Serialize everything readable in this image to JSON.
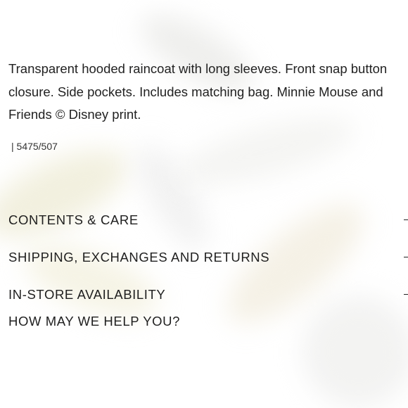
{
  "product": {
    "description": "Transparent hooded raincoat with long sleeves. Front snap button closure. Side pockets. Includes matching bag. Minnie Mouse and Friends © Disney print.",
    "reference": "| 5475/507"
  },
  "accordion": [
    {
      "label": "CONTENTS & CARE",
      "icon": "plus-icon"
    },
    {
      "label": "SHIPPING, EXCHANGES AND RETURNS",
      "icon": "plus-icon"
    },
    {
      "label": "IN-STORE AVAILABILITY",
      "icon": "plus-icon"
    }
  ],
  "help": {
    "label": "HOW MAY WE HELP YOU?"
  }
}
